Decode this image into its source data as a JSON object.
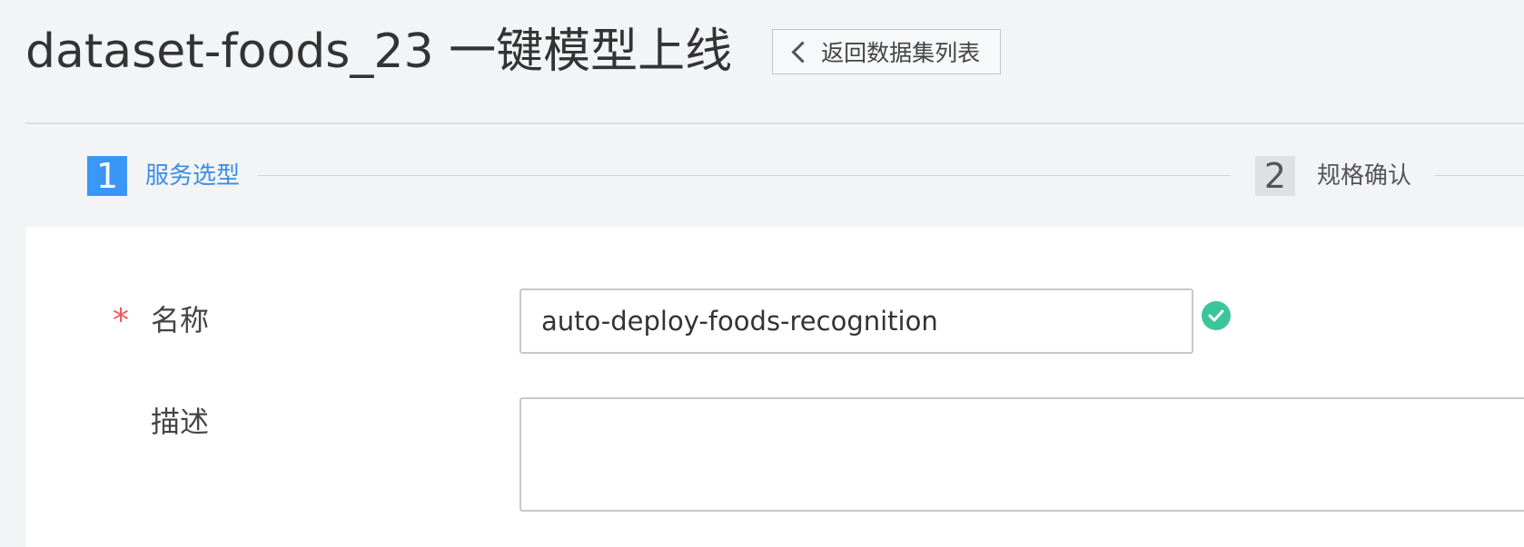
{
  "header": {
    "title": "dataset-foods_23 一键模型上线",
    "back_label": "返回数据集列表",
    "back_icon": "chevron-left-icon"
  },
  "steps": [
    {
      "number": "1",
      "label": "服务选型",
      "state": "active"
    },
    {
      "number": "2",
      "label": "规格确认",
      "state": "inactive"
    }
  ],
  "form": {
    "name": {
      "required_mark": "*",
      "label": "名称",
      "value": "auto-deploy-foods-recognition",
      "status_icon": "check-circle-icon"
    },
    "description": {
      "label": "描述",
      "value": ""
    }
  },
  "colors": {
    "accent": "#3a97f5",
    "required": "#f05a5a",
    "valid": "#3cc59a",
    "background": "#f3f4f6"
  }
}
